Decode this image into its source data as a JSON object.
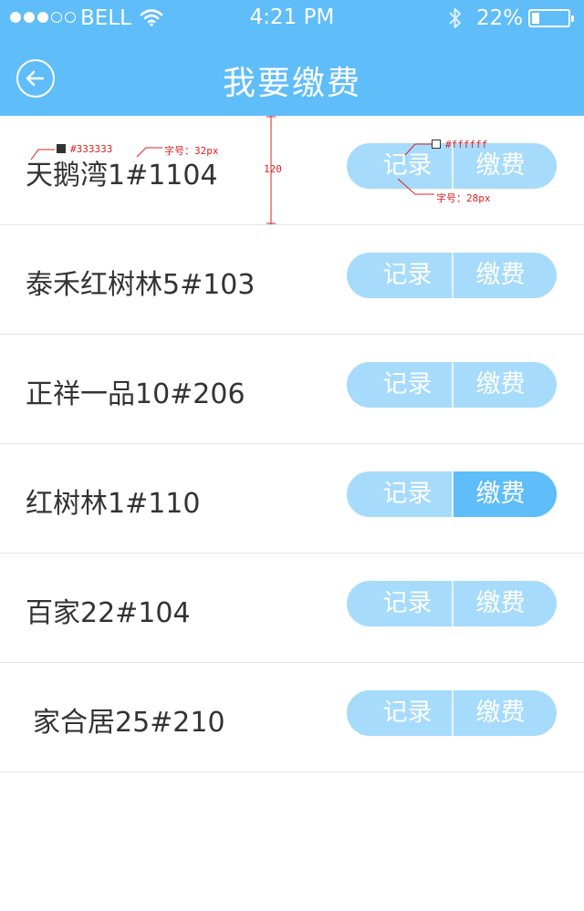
{
  "status_bar": {
    "signal_filled": 3,
    "signal_total": 5,
    "carrier": "BELL",
    "time": "4:21 PM",
    "battery_percent": "22%",
    "battery_level": 0.22
  },
  "header": {
    "title": "我要缴费",
    "back_icon": "back-arrow-circle-icon",
    "background": "#5fbdf9"
  },
  "list": {
    "items": [
      {
        "name": "天鹅湾1#1104",
        "record_label": "记录",
        "pay_label": "缴费",
        "pay_active": false
      },
      {
        "name": "泰禾红树林5#103",
        "record_label": "记录",
        "pay_label": "缴费",
        "pay_active": false
      },
      {
        "name": "正祥一品10#206",
        "record_label": "记录",
        "pay_label": "缴费",
        "pay_active": false
      },
      {
        "name": "红树林1#110",
        "record_label": "记录",
        "pay_label": "缴费",
        "pay_active": true
      },
      {
        "name": "百家22#104",
        "record_label": "记录",
        "pay_label": "缴费",
        "pay_active": false
      },
      {
        "name": "家合居25#210",
        "record_label": "记录",
        "pay_label": "缴费",
        "pay_active": false
      }
    ]
  },
  "annotations": {
    "text_color": "#333333",
    "text_size": "字号：32px",
    "row_height": "120",
    "button_text_color": "#ffffff",
    "button_text_size": "字号：28px"
  },
  "colors": {
    "accent": "#5fbdf9",
    "button_light": "#a6dbfc",
    "text": "#333333",
    "divider": "#e4e4e4"
  }
}
